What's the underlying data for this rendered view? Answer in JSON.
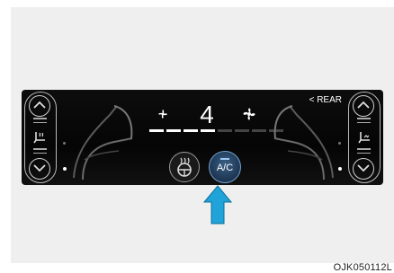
{
  "colors": {
    "panel": "#0a0a0a",
    "ac_active": "#2c4d70",
    "arrow": "#1fa3d8",
    "level_on": "#ffffff",
    "level_off": "#444444"
  },
  "fan": {
    "speed": "4",
    "level_count": 8,
    "levels_active": 4,
    "left_icon": "fan-low-icon",
    "right_icon": "fan-high-icon"
  },
  "rear_label": "< REAR",
  "ac_button": {
    "label": "A/C",
    "active": true
  },
  "steering_heat_button": {
    "icon": "heated-steering-wheel-icon"
  },
  "left_control": {
    "icon": "heated-seat-icon"
  },
  "right_control": {
    "icon": "ventilated-seat-icon"
  },
  "caption": "OJK050112L"
}
